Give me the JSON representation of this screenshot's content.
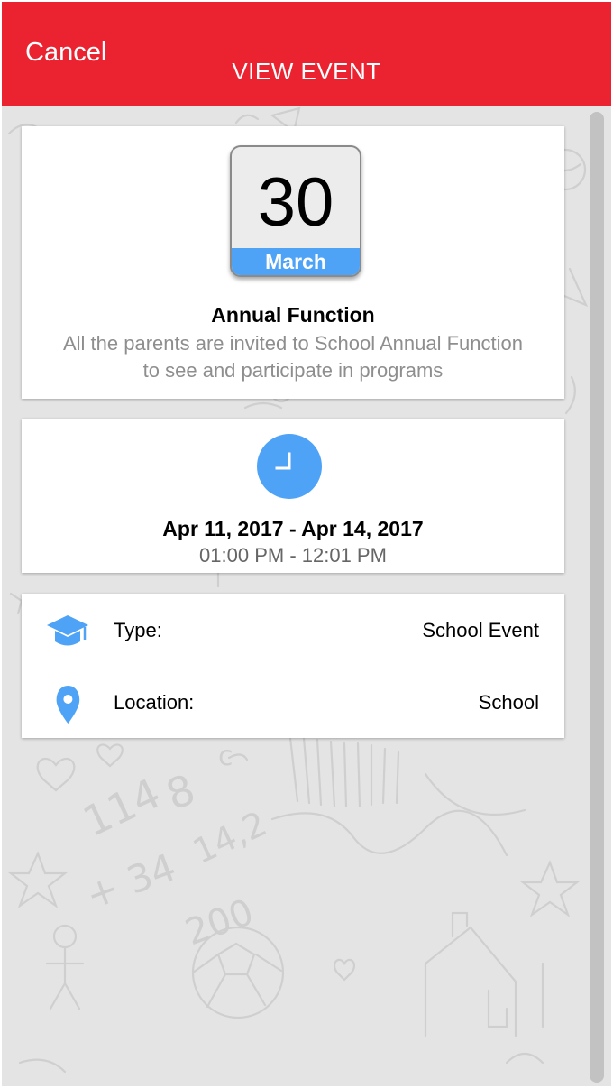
{
  "header": {
    "cancel_label": "Cancel",
    "title": "VIEW EVENT"
  },
  "colors": {
    "header_bg": "#eb2330",
    "accent": "#4fa3f7",
    "background": "#e4e4e4"
  },
  "event": {
    "day": "30",
    "month": "March",
    "title": "Annual Function",
    "description": "All the parents are invited to School Annual Function to see and participate in programs"
  },
  "schedule": {
    "dates": "Apr 11, 2017 - Apr 14, 2017",
    "times": "01:00 PM - 12:01 PM"
  },
  "details": [
    {
      "icon": "graduation-cap-icon",
      "label": "Type:",
      "value": "School Event"
    },
    {
      "icon": "location-pin-icon",
      "label": "Location:",
      "value": "School"
    }
  ]
}
